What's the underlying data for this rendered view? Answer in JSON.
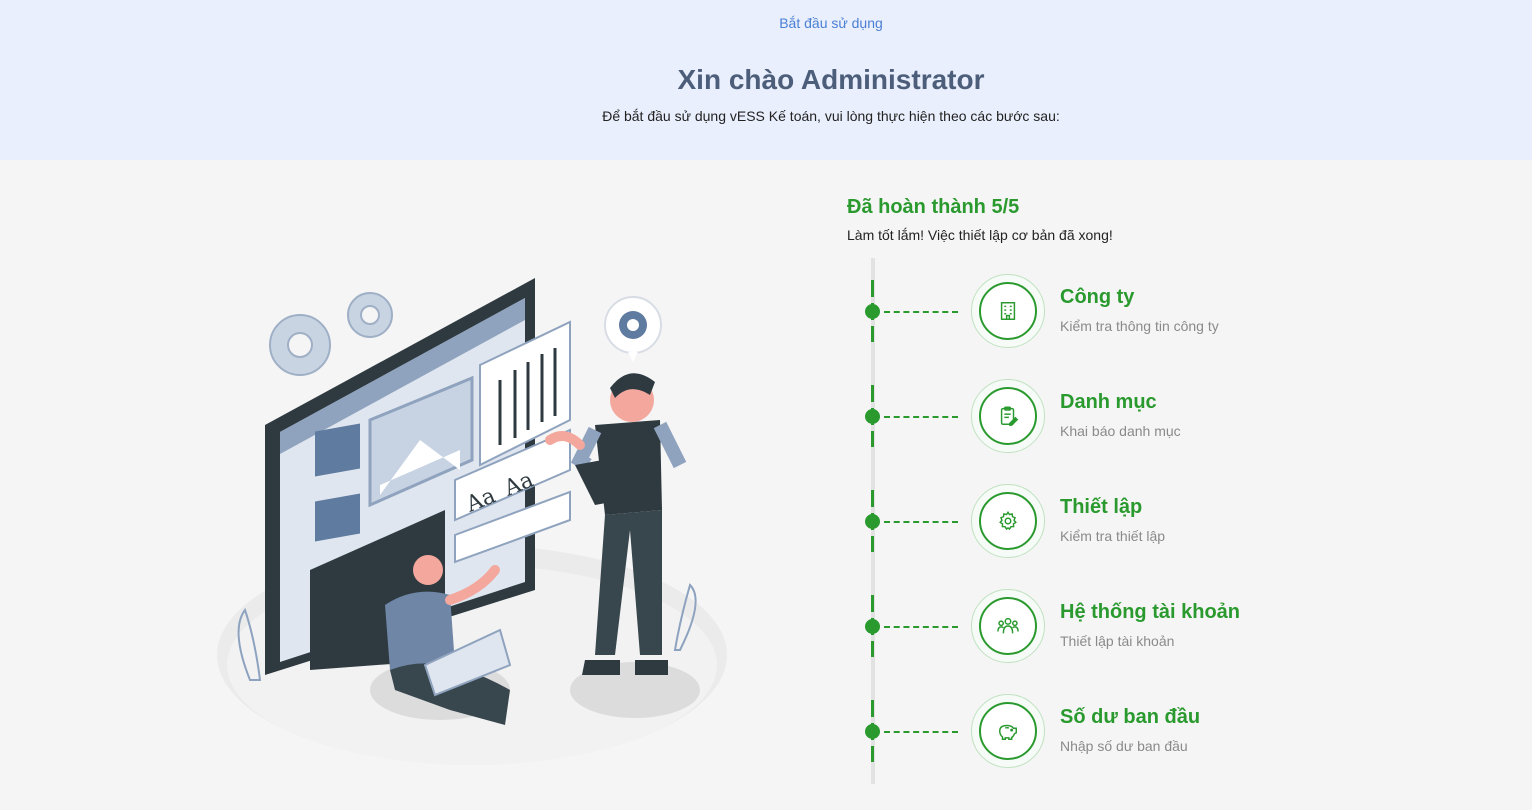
{
  "header": {
    "breadcrumb": "Bắt đầu sử dụng",
    "title": "Xin chào Administrator",
    "subtitle": "Để bắt đầu sử dụng vESS Kế toán, vui lòng thực hiện theo các bước sau:"
  },
  "progress": {
    "title": "Đã hoàn thành 5/5",
    "message": "Làm tốt lắm! Việc thiết lập cơ bản đã xong!",
    "completed": 5,
    "total": 5
  },
  "steps": [
    {
      "label": "Công ty",
      "description": "Kiểm tra thông tin công ty",
      "icon": "building-icon"
    },
    {
      "label": "Danh mục",
      "description": "Khai báo danh mục",
      "icon": "clipboard-edit-icon"
    },
    {
      "label": "Thiết lập",
      "description": "Kiểm tra thiết lập",
      "icon": "gear-icon"
    },
    {
      "label": "Hệ thống tài khoản",
      "description": "Thiết lập tài khoản",
      "icon": "users-group-icon"
    },
    {
      "label": "Số dư ban đầu",
      "description": "Nhập số dư ban đầu",
      "icon": "piggy-bank-icon"
    }
  ],
  "colors": {
    "accent": "#2a9a2f",
    "link": "#4a7fd4",
    "header_bg": "#e9effc",
    "page_bg": "#f5f5f5"
  }
}
